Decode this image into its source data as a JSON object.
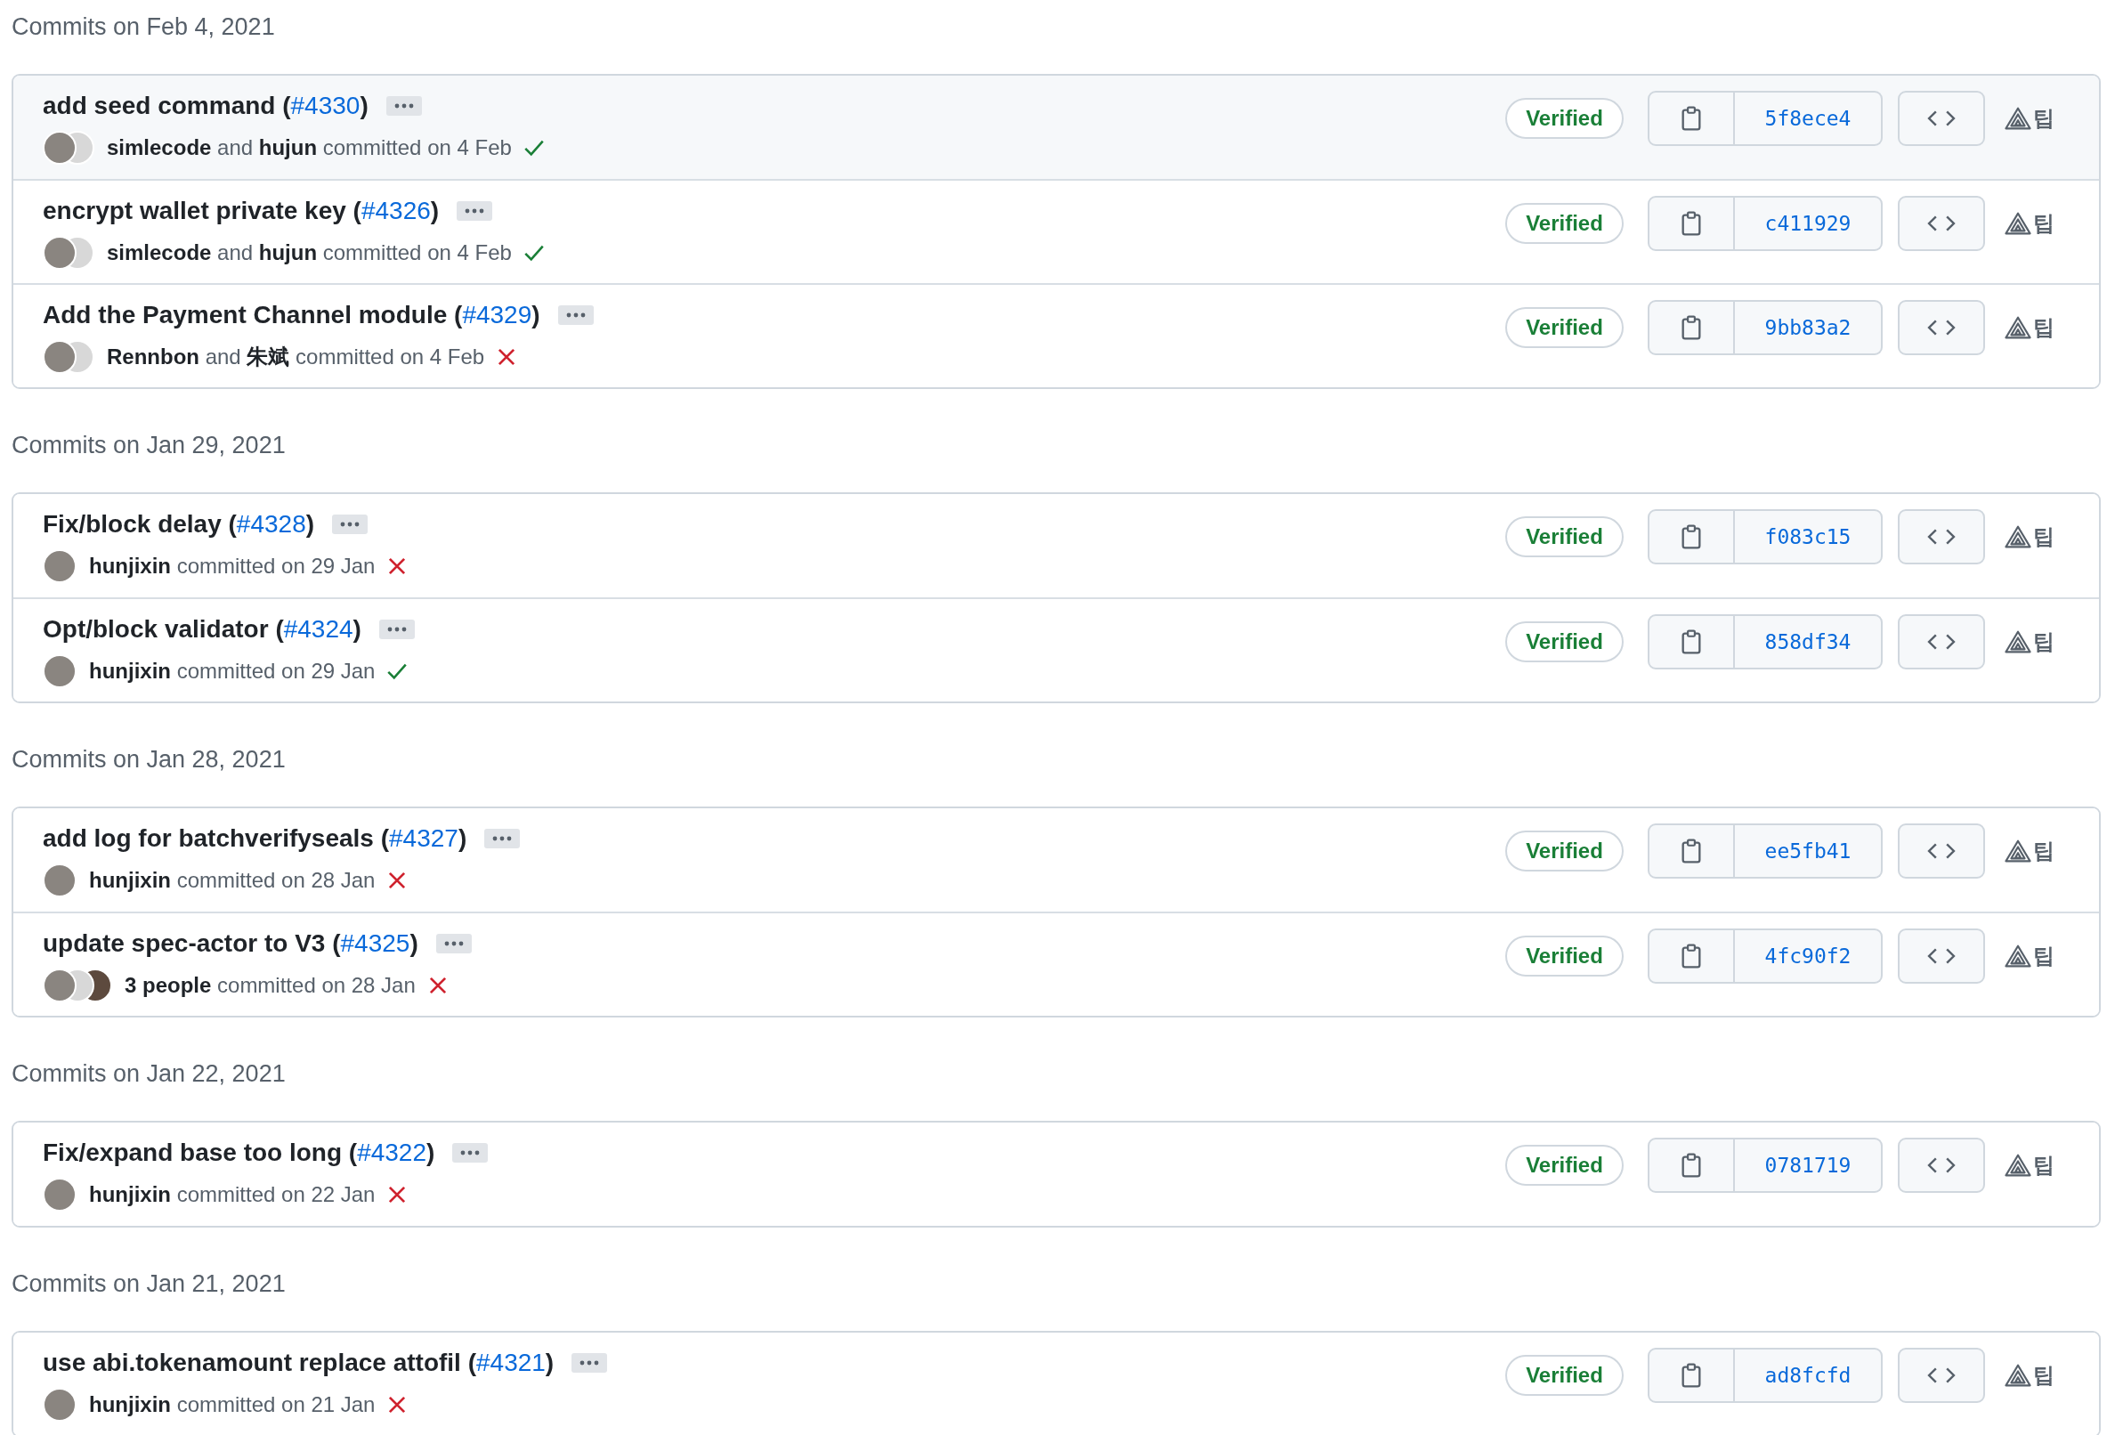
{
  "groups": [
    {
      "heading": "Commits on Feb 4, 2021",
      "commits": [
        {
          "title": {
            "before": "add seed command (",
            "link": "#4330",
            "after": ")"
          },
          "avatars": [
            {
              "kind": "photo"
            },
            {
              "kind": "blank"
            }
          ],
          "byline": "**simlecode** and **hujun** committed on 4 Feb",
          "passed": true,
          "badge": "Verified",
          "sha": "5f8ece4",
          "tip": "팁"
        },
        {
          "title": {
            "before": "encrypt wallet private key (",
            "link": "#4326",
            "after": ")"
          },
          "avatars": [
            {
              "kind": "photo"
            },
            {
              "kind": "blank"
            }
          ],
          "byline": "**simlecode** and **hujun** committed on 4 Feb",
          "passed": true,
          "badge": "Verified",
          "sha": "c411929",
          "tip": "팁"
        },
        {
          "title": {
            "before": "Add the Payment Channel module (",
            "link": "#4329",
            "after": ")"
          },
          "avatars": [
            {
              "kind": "photo"
            },
            {
              "kind": "blank"
            }
          ],
          "byline": "**Rennbon** and **朱斌** committed on 4 Feb",
          "passed": false,
          "badge": "Verified",
          "sha": "9bb83a2",
          "tip": "팁"
        }
      ]
    },
    {
      "heading": "Commits on Jan 29, 2021",
      "commits": [
        {
          "title": {
            "before": "Fix/block delay (",
            "link": "#4328",
            "after": ")"
          },
          "avatars": [
            {
              "kind": "photo"
            }
          ],
          "byline": "**hunjixin** committed on 29 Jan",
          "passed": false,
          "badge": "Verified",
          "sha": "f083c15",
          "tip": "팁"
        },
        {
          "title": {
            "before": "Opt/block validator (",
            "link": "#4324",
            "after": ")"
          },
          "avatars": [
            {
              "kind": "photo"
            }
          ],
          "byline": "**hunjixin** committed on 29 Jan",
          "passed": true,
          "badge": "Verified",
          "sha": "858df34",
          "tip": "팁"
        }
      ]
    },
    {
      "heading": "Commits on Jan 28, 2021",
      "commits": [
        {
          "title": {
            "before": "add log for batchverifyseals (",
            "link": "#4327",
            "after": ")"
          },
          "avatars": [
            {
              "kind": "photo"
            }
          ],
          "byline": "**hunjixin** committed on 28 Jan",
          "passed": false,
          "badge": "Verified",
          "sha": "ee5fb41",
          "tip": "팁"
        },
        {
          "title": {
            "before": "update spec-actor to V3 (",
            "link": "#4325",
            "after": ")"
          },
          "avatars": [
            {
              "kind": "photo"
            },
            {
              "kind": "blank"
            },
            {
              "kind": "photo"
            }
          ],
          "byline": "**3 people** committed on 28 Jan",
          "passed": false,
          "badge": "Verified",
          "sha": "4fc90f2",
          "tip": "팁"
        }
      ]
    },
    {
      "heading": "Commits on Jan 22, 2021",
      "commits": [
        {
          "title": {
            "before": "Fix/expand base too long (",
            "link": "#4322",
            "after": ")"
          },
          "avatars": [
            {
              "kind": "photo"
            }
          ],
          "byline": "**hunjixin** committed on 22 Jan",
          "passed": false,
          "badge": "Verified",
          "sha": "0781719",
          "tip": "팁"
        }
      ]
    },
    {
      "heading": "Commits on Jan 21, 2021",
      "commits": [
        {
          "title": {
            "before": "use abi.tokenamount replace attofil (",
            "link": "#4321",
            "after": ")"
          },
          "avatars": [
            {
              "kind": "photo"
            }
          ],
          "byline": "**hunjixin** committed on 21 Jan",
          "passed": false,
          "badge": "Verified",
          "sha": "ad8fcfd",
          "tip": "팁"
        }
      ]
    }
  ]
}
